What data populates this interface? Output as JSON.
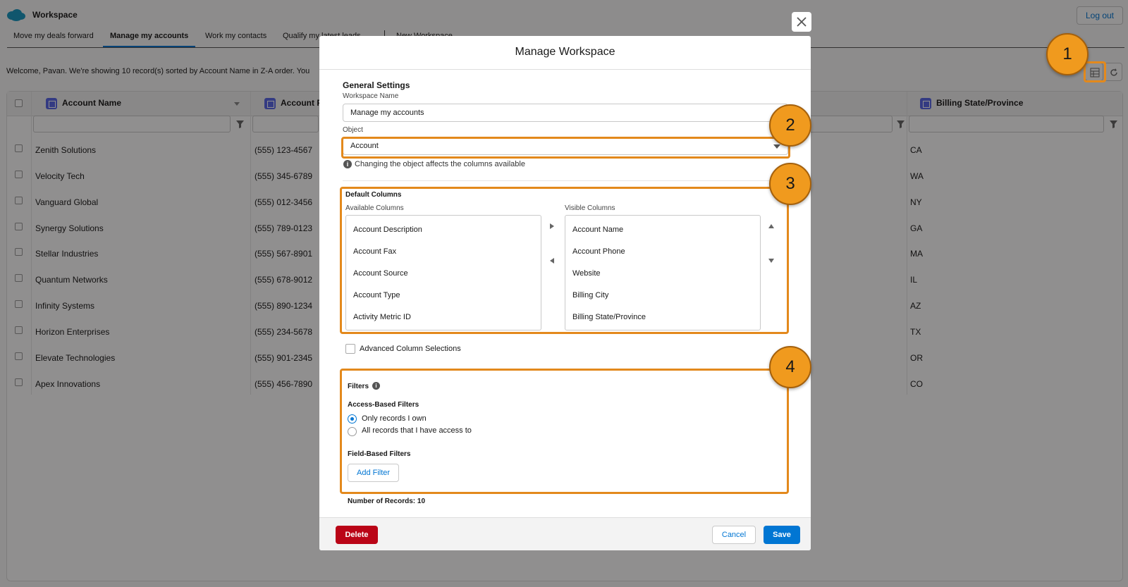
{
  "app": {
    "title": "Workspace",
    "logout_label": "Log out",
    "tabs": [
      {
        "label": "Move my deals forward"
      },
      {
        "label": "Manage my accounts"
      },
      {
        "label": "Work my contacts"
      },
      {
        "label": "Qualify my latest leads"
      },
      {
        "label": "New Workspace"
      }
    ],
    "welcome": "Welcome, Pavan. We're showing 10 record(s) sorted by Account Name in Z-A order. You",
    "columns": [
      {
        "label": "Account Name"
      },
      {
        "label": "Account Phone"
      },
      {
        "label": "Billing State/Province"
      }
    ],
    "rows": [
      {
        "name": "Zenith Solutions",
        "phone": "(555) 123-4567",
        "state": "CA"
      },
      {
        "name": "Velocity Tech",
        "phone": "(555) 345-6789",
        "state": "WA"
      },
      {
        "name": "Vanguard Global",
        "phone": "(555) 012-3456",
        "state": "NY"
      },
      {
        "name": "Synergy Solutions",
        "phone": "(555) 789-0123",
        "state": "GA"
      },
      {
        "name": "Stellar Industries",
        "phone": "(555) 567-8901",
        "state": "MA"
      },
      {
        "name": "Quantum Networks",
        "phone": "(555) 678-9012",
        "state": "IL"
      },
      {
        "name": "Infinity Systems",
        "phone": "(555) 890-1234",
        "state": "AZ"
      },
      {
        "name": "Horizon Enterprises",
        "phone": "(555) 234-5678",
        "state": "TX"
      },
      {
        "name": "Elevate Technologies",
        "phone": "(555) 901-2345",
        "state": "OR"
      },
      {
        "name": "Apex Innovations",
        "phone": "(555) 456-7890",
        "state": "CO"
      }
    ]
  },
  "modal": {
    "title": "Manage Workspace",
    "general_settings": "General Settings",
    "workspace_name_label": "Workspace Name",
    "workspace_name_value": "Manage my accounts",
    "object_label": "Object",
    "object_value": "Account",
    "object_help": "Changing the object affects the columns available",
    "default_columns": "Default Columns",
    "available_label": "Available Columns",
    "visible_label": "Visible Columns",
    "available": [
      "Account Description",
      "Account Fax",
      "Account Source",
      "Account Type",
      "Activity Metric ID"
    ],
    "visible": [
      "Account Name",
      "Account Phone",
      "Website",
      "Billing City",
      "Billing State/Province"
    ],
    "advanced_label": "Advanced Column Selections",
    "filters_title": "Filters",
    "access_filters_title": "Access-Based Filters",
    "radio_own": "Only records I own",
    "radio_all": "All records that I have access to",
    "field_filters_title": "Field-Based Filters",
    "add_filter_label": "Add Filter",
    "records_count": "Number of Records: 10",
    "delete_label": "Delete",
    "cancel_label": "Cancel",
    "save_label": "Save"
  },
  "callouts": [
    "1",
    "2",
    "3",
    "4"
  ],
  "colors": {
    "accent": "#0176d3",
    "destructive": "#ba0517",
    "annotation": "#e3891c",
    "callout_fill": "#f09a1e"
  }
}
